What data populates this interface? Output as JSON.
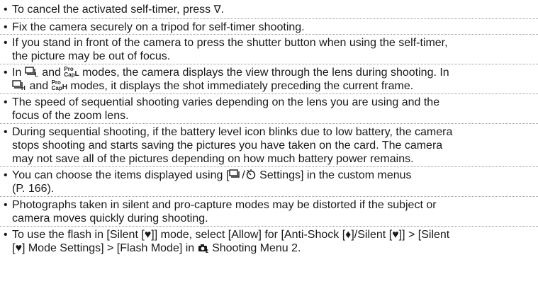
{
  "icons": {
    "triangle_down": "∇",
    "timer": "ὔ",
    "heart": "[♥]",
    "diamond": "[♦]",
    "pro_top": "Pro",
    "pro_bottom": "Cap",
    "sub_L": "L",
    "sub_H": "H",
    "camera_icon": "camera-shooting-menu-icon",
    "sequential_icon": "sequential-shooting-icon"
  },
  "notes": [
    {
      "lines": [
        "To cancel the activated self-timer, press "
      ]
    },
    {
      "lines": [
        "Fix the camera securely on a tripod for self-timer shooting."
      ]
    },
    {
      "lines": [
        "If you stand in front of the camera to press the shutter button when using the self-timer,",
        "the picture may be out of focus."
      ]
    },
    {
      "lines": [
        "In ",
        " and ",
        " modes, the camera displays the view through the lens during shooting. In",
        " and ",
        " modes, it displays the shot immediately preceding the current frame."
      ]
    },
    {
      "lines": [
        "The speed of sequential shooting varies depending on the lens you are using and the",
        "focus of the zoom lens."
      ]
    },
    {
      "lines": [
        "During sequential shooting, if the battery level icon blinks due to low battery, the camera",
        "stops shooting and starts saving the pictures you have taken on the card. The camera",
        "may not save all of the pictures depending on how much battery power remains."
      ]
    },
    {
      "lines": [
        "You can choose the items displayed using [",
        " Settings] in the custom menus",
        "(P. 166)."
      ]
    },
    {
      "lines": [
        "Photographs taken in silent and pro-capture modes may be distorted if the subject or",
        "camera moves quickly during shooting."
      ]
    },
    {
      "lines": [
        "To use the flash in [Silent ",
        "] mode, select [Allow] for [Anti-Shock ",
        "/Silent ",
        "] > [Silent",
        " Mode Settings] > [Flash Mode] in ",
        " Shooting Menu 2."
      ]
    }
  ]
}
